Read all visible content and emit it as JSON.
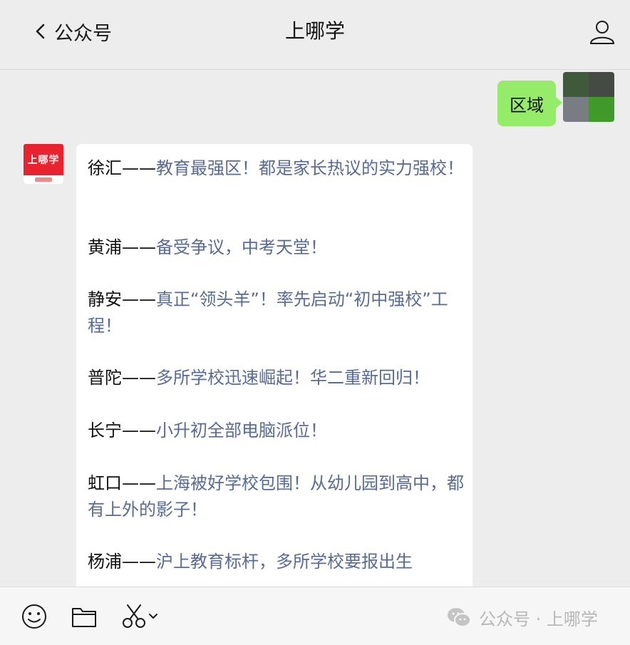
{
  "header": {
    "back_label": "公众号",
    "title": "上哪学"
  },
  "chat": {
    "outgoing_message": "区域",
    "sender_logo_text": "上哪学",
    "districts": [
      {
        "name": "徐汇——",
        "desc": "教育最强区！都是家长热议的实力强校！"
      },
      {
        "name": "黄浦——",
        "desc": "备受争议，中考天堂！"
      },
      {
        "name": "静安——",
        "desc": "真正“领头羊”！率先启动“初中强校”工程！"
      },
      {
        "name": "普陀——",
        "desc": "多所学校迅速崛起！华二重新回归！"
      },
      {
        "name": "长宁——",
        "desc": "小升初全部电脑派位！"
      },
      {
        "name": "虹口——",
        "desc": "上海被好学校包围！从幼儿园到高中，都有上外的影子！"
      },
      {
        "name": "杨浦——",
        "desc": "沪上教育标杆，多所学校要报出生"
      }
    ]
  },
  "bottom": {
    "icons": [
      "smile-icon",
      "folder-icon",
      "scissors-icon"
    ],
    "watermark": "公众号 · 上哪学"
  },
  "colors": {
    "background": "#ededed",
    "outgoing_bubble": "#95ec69",
    "link_blue": "#576b95",
    "logo_red": "#e8222e"
  }
}
